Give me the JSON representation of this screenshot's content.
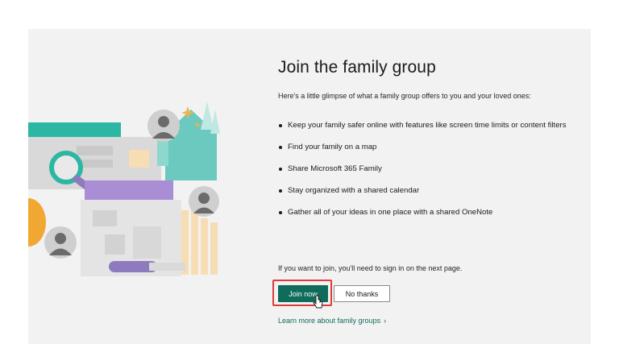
{
  "page": {
    "title": "Join the family group",
    "intro": "Here's a little glimpse of what a family group offers to you and your loved ones:"
  },
  "features": [
    "Keep your family safer online with features like screen time limits or content filters",
    "Find your family on a map",
    "Share Microsoft 365 Family",
    "Stay organized with a shared calendar",
    "Gather all of your ideas in one place with a shared OneNote"
  ],
  "signin_note": "If you want to join, you'll need to sign in on the next page.",
  "actions": {
    "join_label": "Join now",
    "decline_label": "No thanks"
  },
  "learn_more": {
    "label": "Learn more about family groups",
    "chevron": "›"
  },
  "colors": {
    "accent": "#0f6b5a",
    "highlight": "#e03a3a",
    "panel_bg": "#f2f2f2",
    "teal": "#2bb7a3",
    "purple": "#a98ed6"
  },
  "icons": [
    "magnifier-icon",
    "person-avatar-icon",
    "house-icon",
    "pen-icon",
    "sparkle-icon",
    "mouse-pointer-icon"
  ]
}
